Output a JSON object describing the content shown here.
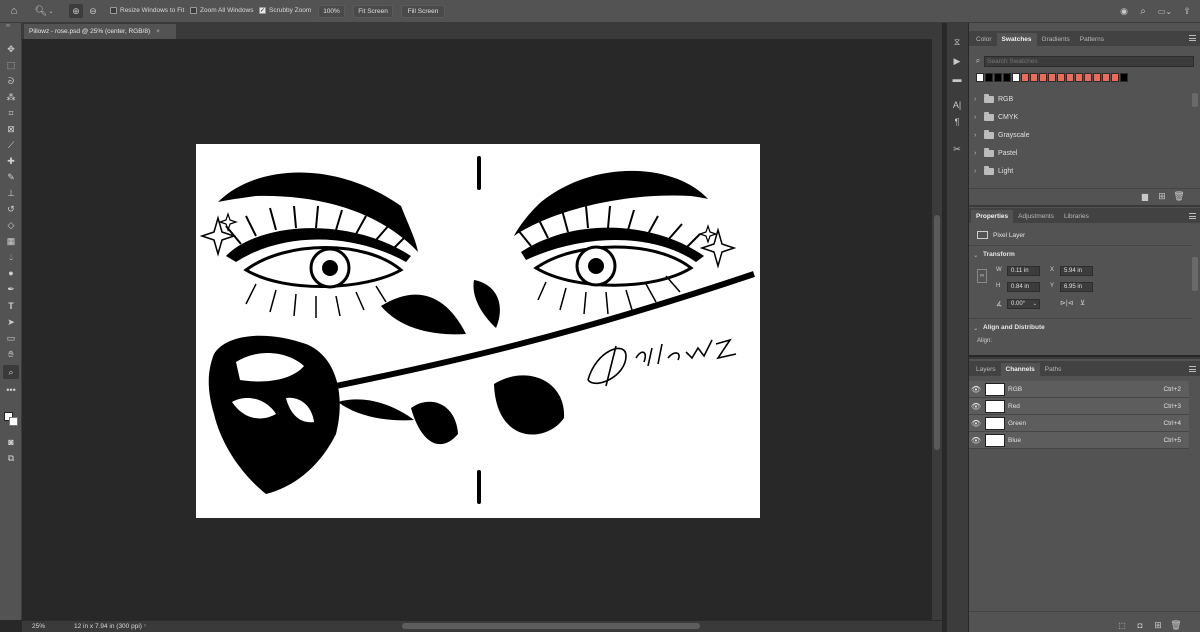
{
  "options_bar": {
    "resize_windows_label": "Resize Windows to Fit",
    "zoom_all_label": "Zoom All Windows",
    "scrubby_zoom_label": "Scrubby Zoom",
    "zoom_100_label": "100%",
    "fit_screen_label": "Fit Screen",
    "fill_screen_label": "Fill Screen"
  },
  "document": {
    "tab_title": "Pillowz - rose.psd @ 25% (center, RGB/8)",
    "close_glyph": "×",
    "artwork_text": "Pillowz"
  },
  "status": {
    "zoom": "25%",
    "doc_info": "12 in x 7.94 in (300 ppi)"
  },
  "swatches_panel": {
    "tabs": [
      "Color",
      "Swatches",
      "Gradients",
      "Patterns"
    ],
    "active_tab": "Swatches",
    "search_placeholder": "Search Swatches",
    "recent_colors": [
      "#ffffff",
      "#000000",
      "#000000",
      "#000000",
      "#ffffff",
      "#ee6b5a",
      "#ee6b5a",
      "#ee6b5a",
      "#ee6b5a",
      "#ee6b5a",
      "#ee6b5a",
      "#ee6b5a",
      "#ee6b5a",
      "#ee6b5a",
      "#ee6b5a",
      "#ee6b5a",
      "#000000"
    ],
    "groups": [
      "RGB",
      "CMYK",
      "Grayscale",
      "Pastel",
      "Light"
    ]
  },
  "properties_panel": {
    "tabs": [
      "Properties",
      "Adjustments",
      "Libraries"
    ],
    "active_tab": "Properties",
    "layer_type": "Pixel Layer",
    "transform_label": "Transform",
    "w_label": "W",
    "w_value": "0.11 in",
    "h_label": "H",
    "h_value": "0.84 in",
    "x_label": "X",
    "x_value": "5.94 in",
    "y_label": "Y",
    "y_value": "6.95 in",
    "angle_value": "0.00°",
    "align_section_label": "Align and Distribute",
    "align_label": "Align:"
  },
  "channels_panel": {
    "tabs": [
      "Layers",
      "Channels",
      "Paths"
    ],
    "active_tab": "Channels",
    "channels": [
      {
        "name": "RGB",
        "shortcut": "Ctrl+2"
      },
      {
        "name": "Red",
        "shortcut": "Ctrl+3"
      },
      {
        "name": "Green",
        "shortcut": "Ctrl+4"
      },
      {
        "name": "Blue",
        "shortcut": "Ctrl+5"
      }
    ]
  },
  "colors": {
    "ui_dark": "#282828",
    "ui_panel": "#535353",
    "accent_swatch": "#ee6b5a"
  }
}
